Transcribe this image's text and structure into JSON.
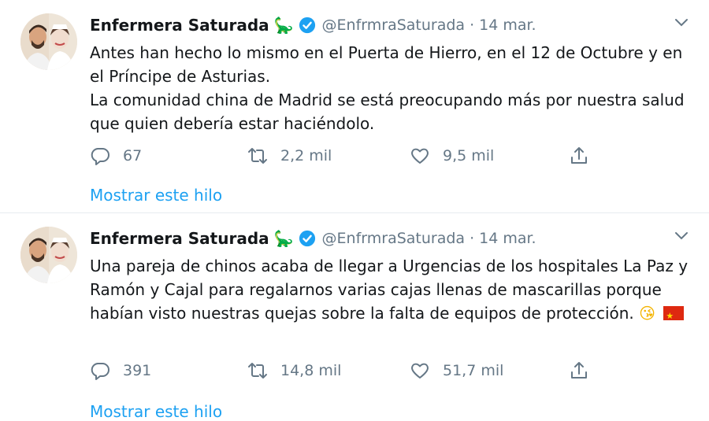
{
  "tweets": [
    {
      "author": "Enfermera Saturada",
      "author_emoji": "🦕",
      "handle": "@EnfrmraSaturada",
      "separator": "·",
      "date": "14 mar.",
      "text_lines": [
        "Antes han hecho lo mismo en el Puerta de Hierro, en el 12 de Octubre y en el Príncipe de Asturias.",
        "La comunidad china de Madrid se está preocupando más por nuestra salud que quien debería estar haciéndolo."
      ],
      "text_emoji": "",
      "replies": "67",
      "retweets": "2,2 mil",
      "likes": "9,5 mil",
      "thread_link": "Mostrar este hilo"
    },
    {
      "author": "Enfermera Saturada",
      "author_emoji": "🦕",
      "handle": "@EnfrmraSaturada",
      "separator": "·",
      "date": "14 mar.",
      "text_lines": [
        "Una pareja de chinos acaba de llegar a Urgencias de los hospitales La Paz y Ramón y Cajal para regalarnos varias cajas llenas de mascarillas porque habían visto nuestras quejas sobre la falta de equipos de protección."
      ],
      "text_emoji": "😘",
      "replies": "391",
      "retweets": "14,8 mil",
      "likes": "51,7 mil",
      "thread_link": "Mostrar este hilo"
    }
  ],
  "icons": {
    "verified": "verified-badge-icon",
    "caret": "chevron-down-icon",
    "reply": "reply-icon",
    "retweet": "retweet-icon",
    "like": "heart-icon",
    "share": "share-icon",
    "flag": "china-flag-icon"
  },
  "colors": {
    "text": "#14171a",
    "muted": "#657786",
    "accent": "#1da1f2",
    "divider": "#e6ecf0"
  }
}
